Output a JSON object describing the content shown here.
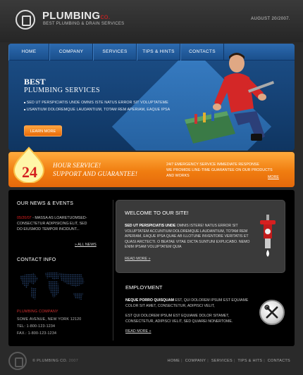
{
  "header": {
    "brand": "PLUMBING",
    "brand_suffix": "co.",
    "tagline": "BEST PLUMBING & DRAIN SERVICES",
    "date": "AUGUST 20/2007."
  },
  "nav": {
    "items": [
      {
        "label": "HOME"
      },
      {
        "label": "COMPANY"
      },
      {
        "label": "SERVICES"
      },
      {
        "label": "TIPS & HINTS"
      },
      {
        "label": "CONTACTS"
      }
    ]
  },
  "hero": {
    "title1": "BEST",
    "title2": "PLUMBING  SERVICES",
    "line1": "SED UT PERSPICIATIS UNDE OMNIS ISTE NATUS ERROR SIT VOLUPTATEME",
    "line2": "USANTIUM DOLOREMQUE LAUDANTIUM, TOTAM REM APERIAM, EAQUE IPSA",
    "button": "LEARN MORE"
  },
  "banner": {
    "number": "24",
    "text_line1": "HOUR SERVICE!",
    "text_line2": "SUPPORT AND GUARANTEE!",
    "right_line1": "24/7 EMERGENCY SERVICE IMMEDIATE RESPONSE",
    "right_line2": "WE PROMIDE LINE-TIME GUARANTEE ON OUR PRODUCTS",
    "right_line3": "AND WORKS",
    "more": "MORE"
  },
  "news": {
    "title": "OUR NEWS & EVENTS",
    "date": "05/20/07",
    "line1": " - MASSA AS LOARETUOMSED-",
    "line2": "CONSECTETUR ADIPISICING ELIT, SED",
    "line3": "DO EIUSMOD TEMPOR INCIDUNT...",
    "all_news": "ALL NEWS"
  },
  "contact": {
    "title": "CONTACT INFO",
    "company": "PLUMBING COMPANY",
    "address": "SOME AVENUE, NEW YORK 12120",
    "tel": "TEL:    1-800-123-1234",
    "fax": "FAX.:  1-800-123-1234"
  },
  "welcome": {
    "title": "WELCOME",
    "title_suffix": " TO OUR SITE!",
    "lead": "SED UT PERSPICIATIS UNDE",
    "body": " OMNIS ISTERE! NATUS ERROR SIT VOLUPTATEM ACCUNTIUM DOLOREMQUE LAUDANTIUM, TOTAM REM APERIAM, EAQUE IPSA QUAE AB ILLOTUNE INVENTORE VERITATIS ET QUASI ARCTECTI. O BEATAE VITAE DICTA SUNTUNI EXPLICABO. NEMO ENIM IPSAM VOLUPTATEM QUIA",
    "read_more": "READ MORE"
  },
  "employment": {
    "title": "EMPLOYMENT",
    "p1_lead": "NEQUE PORRO QUISQUAM",
    "p1_body": " EST, QUI DOLOREM IPSUM EST EQUIAME COLOR SIT AMET, CONSECTETUR, ADIPISCI VELIT,",
    "p2": "EST QUI DOLOREM IPSUM EST EQUIAME DOLOR SITAMET, CONSECTETUR, ADIPISCI VELIT, SED QUIAREI NONERTOME.",
    "read_more": "READ MORE"
  },
  "footer": {
    "copyright": "© PLUMBING CO.",
    "year": "2007",
    "links": [
      "HOME",
      "COMPANY",
      "SERVICES",
      "TIPS & HITS",
      "CONTACTS"
    ]
  },
  "colors": {
    "accent_red": "#d62020",
    "nav_blue": "#1a4f8c",
    "banner_orange": "#f07d10"
  },
  "icons": [
    "logo-icon",
    "hydrant-icon",
    "tools-icon",
    "world-map-icon"
  ]
}
